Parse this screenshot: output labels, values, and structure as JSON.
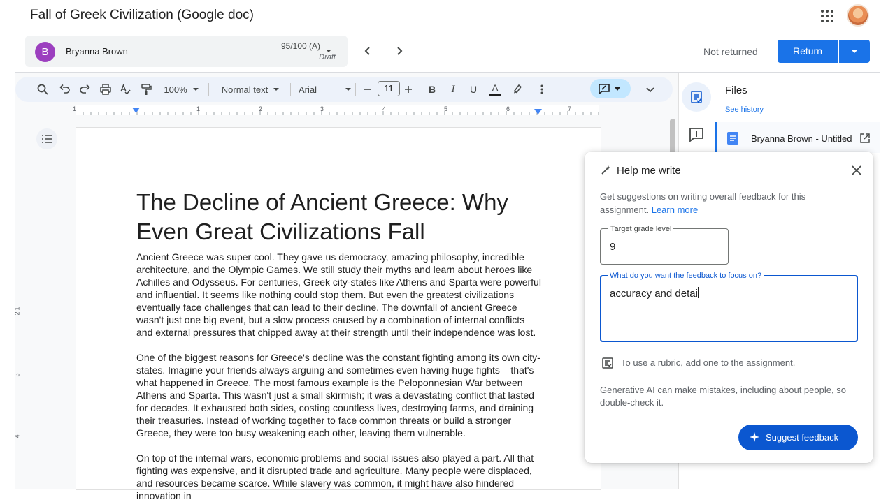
{
  "header": {
    "doc_title": "Fall of Greek Civilization (Google doc)"
  },
  "grading": {
    "student_initial": "B",
    "student_name": "Bryanna Brown",
    "grade": "95/100 (A)",
    "grade_status": "Draft",
    "return_status": "Not returned",
    "return_label": "Return"
  },
  "toolbar": {
    "zoom": "100%",
    "style": "Normal text",
    "font": "Arial",
    "font_size": "11",
    "bold": "B",
    "italic": "I",
    "underline": "U",
    "text_color": "A"
  },
  "ruler": {
    "h": [
      "1",
      "1",
      "2",
      "3",
      "4",
      "5",
      "6",
      "7"
    ],
    "v": [
      "1",
      "2",
      "3",
      "4"
    ]
  },
  "document": {
    "heading": "The Decline of Ancient Greece: Why Even Great Civilizations Fall",
    "paragraphs": [
      "Ancient Greece was super cool. They gave us democracy, amazing philosophy, incredible architecture, and the Olympic Games. We still study their myths and learn about heroes like Achilles and Odysseus. For centuries, Greek city-states like Athens and Sparta were powerful and influential. It seems like nothing could stop them. But even the greatest civilizations eventually face challenges that can lead to their decline. The downfall of ancient Greece wasn't just one big event, but a slow process caused by a combination of internal conflicts and external pressures that chipped away at their strength until their independence was lost.",
      "One of the biggest reasons for Greece's decline was the constant fighting among its own city-states. Imagine your friends always arguing and sometimes even having huge fights – that's what happened in Greece. The most famous example is the Peloponnesian War between Athens and Sparta. This wasn't just a small skirmish; it was a devastating conflict that lasted for decades. It exhausted both sides, costing countless lives, destroying farms, and draining their treasuries. Instead of working together to face common threats or build a stronger Greece, they were too busy weakening each other, leaving them vulnerable.",
      "On top of the internal wars, economic problems and social issues also played a part. All that fighting was expensive, and it disrupted trade and agriculture. Many people were displaced, and resources became scarce. While slavery was common, it might have also hindered innovation in"
    ]
  },
  "files_panel": {
    "title": "Files",
    "see_history": "See history",
    "file_name": "Bryanna Brown - Untitled document"
  },
  "help_me_write": {
    "title": "Help me write",
    "description": "Get suggestions on writing overall feedback for this assignment.",
    "learn_more": "Learn more",
    "grade_label": "Target grade level",
    "grade_value": "9",
    "focus_label": "What do you want the feedback to focus on?",
    "focus_value": "accuracy and detai",
    "rubric_text": "To use a rubric, add one to the assignment.",
    "disclaimer": "Generative AI can make mistakes, including about people, so double-check it.",
    "suggest_label": "Suggest feedback"
  },
  "colors": {
    "primary": "#1a73e8",
    "focus_border": "#0b57d0",
    "avatar": "#9c3fbf",
    "toolbar_bg": "#edf2fa"
  }
}
